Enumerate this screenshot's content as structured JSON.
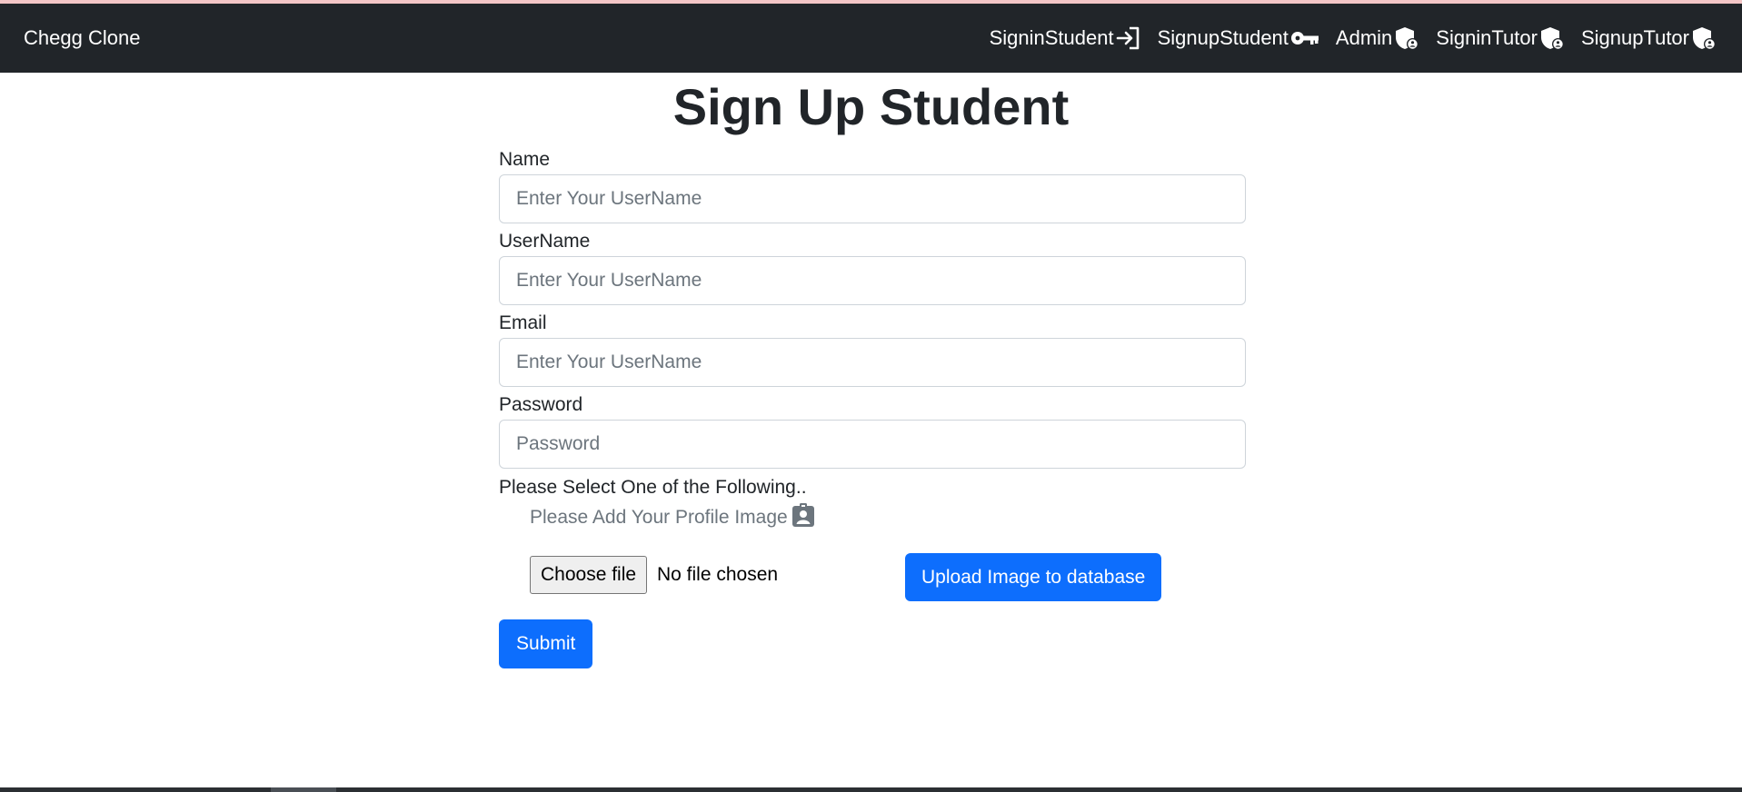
{
  "navbar": {
    "brand": "Chegg Clone",
    "items": [
      {
        "label": "SigninStudent",
        "icon": "sign-in-icon"
      },
      {
        "label": "SignupStudent",
        "icon": "key-icon"
      },
      {
        "label": "Admin",
        "icon": "shield-user-icon"
      },
      {
        "label": "SigninTutor",
        "icon": "shield-user-icon"
      },
      {
        "label": "SignupTutor",
        "icon": "shield-user-icon"
      }
    ]
  },
  "page": {
    "title": "Sign Up Student"
  },
  "form": {
    "fields": [
      {
        "label": "Name",
        "placeholder": "Enter Your UserName",
        "type": "text"
      },
      {
        "label": "UserName",
        "placeholder": "Enter Your UserName",
        "type": "text"
      },
      {
        "label": "Email",
        "placeholder": "Enter Your UserName",
        "type": "email"
      },
      {
        "label": "Password",
        "placeholder": "Password",
        "type": "password"
      }
    ],
    "select_prompt": "Please Select One of the Following..",
    "profile_hint": "Please Add Your Profile Image",
    "profile_icon": "id-badge-icon",
    "file_button": "Choose file",
    "file_status": "No file chosen",
    "upload_button": "Upload Image to database",
    "submit_button": "Submit"
  },
  "colors": {
    "navbar_bg": "#212529",
    "primary": "#0d6efd",
    "placeholder": "#6c757d"
  }
}
